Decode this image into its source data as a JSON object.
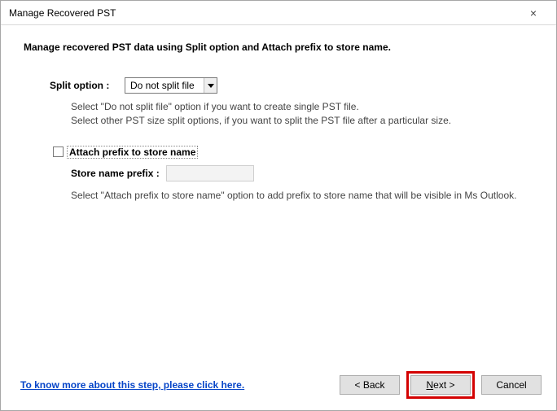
{
  "window": {
    "title": "Manage Recovered PST",
    "close_symbol": "×"
  },
  "heading": "Manage recovered PST data using Split option and Attach prefix to store name.",
  "split": {
    "label": "Split option :",
    "selected": "Do not split file",
    "hint_line1": "Select \"Do not split file\" option if you want to create single PST file.",
    "hint_line2": "Select other PST size split options, if you want to split the PST file after a particular size."
  },
  "prefix": {
    "checkbox_label": "Attach prefix to store name",
    "checked": false,
    "field_label": "Store name prefix :",
    "value": "",
    "hint": "Select \"Attach prefix to store name\" option to add prefix to store name that will be visible in Ms Outlook."
  },
  "footer": {
    "help_link": "To know more about this step, please click here.",
    "back": "< Back",
    "next_prefix": "N",
    "next_suffix": "ext >",
    "cancel": "Cancel"
  }
}
